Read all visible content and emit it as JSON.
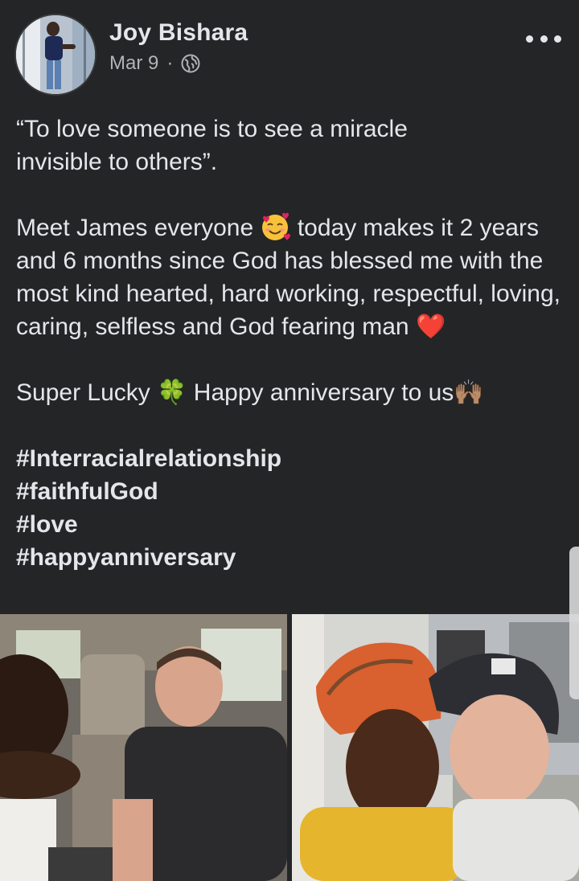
{
  "post": {
    "author": "Joy Bishara",
    "date": "Mar 9",
    "separator": "·",
    "audience_icon": "globe-icon",
    "quote_line1": "“To love someone is to see a miracle",
    "quote_line2": "invisible to others”.",
    "para2_part1": "Meet James everyone",
    "para2_part2": " today makes it 2 years and 6 months since God has blessed me with the most kind hearted,  hard working, respectful, loving, caring, selfless and God fearing man ",
    "para3_part1": "Super Lucky ",
    "para3_part2": " Happy anniversary to us",
    "hashtags": [
      "#Interracialrelationship",
      "#faithfulGod",
      "#love",
      "#happyanniversary"
    ],
    "emoji_face": "smiling-face-with-hearts",
    "emoji_heart": "❤️",
    "emoji_clover": "🍀",
    "emoji_hands": "🙌🏽"
  },
  "colors": {
    "background": "#242526",
    "text_primary": "#e4e6eb",
    "text_secondary": "#b0b3b8"
  }
}
